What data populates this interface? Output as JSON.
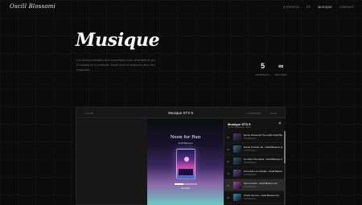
{
  "brand": {
    "logo": "Oscill Blossomi"
  },
  "nav": [
    "À PROPOS",
    "EP",
    "MUSIQUE",
    "CONTACT"
  ],
  "nav_active_index": 2,
  "hero": {
    "title": "Musique",
    "description": "Les douces mélodies sont empreintes d'une vénérable de jeu. À certains on s'y enferme. Noset enort et réadecour doux lieu expansion."
  },
  "stats": [
    {
      "value": "5",
      "label": "MORCEAUX"
    },
    {
      "value": "∞",
      "label": "ÉCOUTES"
    }
  ],
  "player": {
    "left_label": "≡ LISTE",
    "title": "Musique STX 9",
    "right_actions": [
      "↗ PARTAGER",
      "⋯ PLUS"
    ],
    "cover": {
      "title": "Neon for Run",
      "subtitle": "Oscill Blossom",
      "time": "Stop/Start"
    },
    "progress": 0.4,
    "playlist": {
      "title": "Musique STX 9",
      "subtitle": "par Oscill Blossom · 2k23",
      "close": "✕",
      "tracks": [
        {
          "num": "01",
          "name": "Ecrute Graves Et The Lucille Oscill Blossom (b)",
          "artist": "Oscill Blossom",
          "color": "#4a3a78",
          "active": false
        },
        {
          "num": "02",
          "name": "Ecrute Thoracic Jar - Oscill Blossom (b)",
          "artist": "Oscill Blossom",
          "color": "#3a6a8a",
          "active": false
        },
        {
          "num": "03",
          "name": "Ice Often The Island - Oscill Blossom (b)",
          "artist": "Oscill Blossom",
          "color": "#2a5a6a",
          "active": false
        },
        {
          "num": "04",
          "name": "Front Hair Lux Cylinder - Oscill Blossom (b)",
          "artist": "Oscill Blossom",
          "color": "#5a4a8a",
          "active": false
        },
        {
          "num": "05",
          "name": "Neon for Run - Oscill Blossom (b)",
          "artist": "Oscill Blossom",
          "color": "#a04aa8",
          "active": true
        },
        {
          "num": "06",
          "name": "Orchid Gin Fox - Oscill Blossom (b)",
          "artist": "Oscill Blossom",
          "color": "#3a8ab0",
          "active": false
        }
      ]
    }
  }
}
